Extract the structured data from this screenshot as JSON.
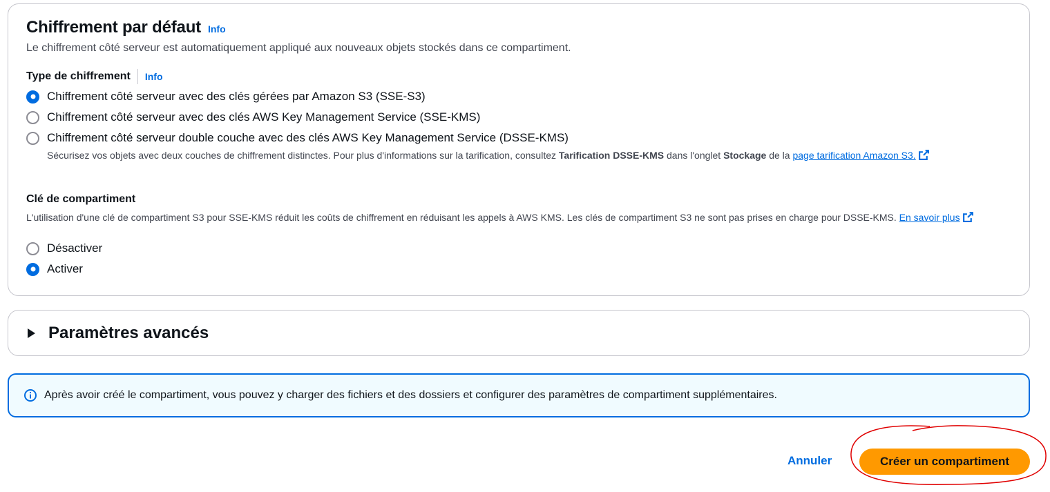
{
  "encryption": {
    "title": "Chiffrement par défaut",
    "info": "Info",
    "description": "Le chiffrement côté serveur est automatiquement appliqué aux nouveaux objets stockés dans ce compartiment.",
    "type_label": "Type de chiffrement",
    "type_info": "Info",
    "options": [
      {
        "label": "Chiffrement côté serveur avec des clés gérées par Amazon S3 (SSE-S3)",
        "checked": true
      },
      {
        "label": "Chiffrement côté serveur avec des clés AWS Key Management Service (SSE-KMS)",
        "checked": false
      },
      {
        "label": "Chiffrement côté serveur double couche avec des clés AWS Key Management Service (DSSE-KMS)",
        "checked": false
      }
    ],
    "dsse_desc": {
      "part1": "Sécurisez vos objets avec deux couches de chiffrement distinctes. Pour plus d'informations sur la tarification, consultez ",
      "bold1": "Tarification DSSE-KMS",
      "part2": " dans l'onglet ",
      "bold2": "Stockage",
      "part3": " de la ",
      "link": "page tarification Amazon S3."
    }
  },
  "bucket_key": {
    "label": "Clé de compartiment",
    "description": "L'utilisation d'une clé de compartiment S3 pour SSE-KMS réduit les coûts de chiffrement en réduisant les appels à AWS KMS. Les clés de compartiment S3 ne sont pas prises en charge pour DSSE-KMS. ",
    "learn_more": "En savoir plus",
    "options": [
      {
        "label": "Désactiver",
        "checked": false
      },
      {
        "label": "Activer",
        "checked": true
      }
    ]
  },
  "advanced": {
    "title": "Paramètres avancés"
  },
  "alert": {
    "text": "Après avoir créé le compartiment, vous pouvez y charger des fichiers et des dossiers et configurer des paramètres de compartiment supplémentaires."
  },
  "footer": {
    "cancel": "Annuler",
    "create": "Créer un compartiment"
  },
  "colors": {
    "accent": "#006ce0",
    "primary_button": "#ff9900",
    "annotation": "#e00000"
  },
  "icons": {
    "alert": "info-circle-icon",
    "external": "external-link-icon",
    "expand": "caret-right-icon"
  }
}
